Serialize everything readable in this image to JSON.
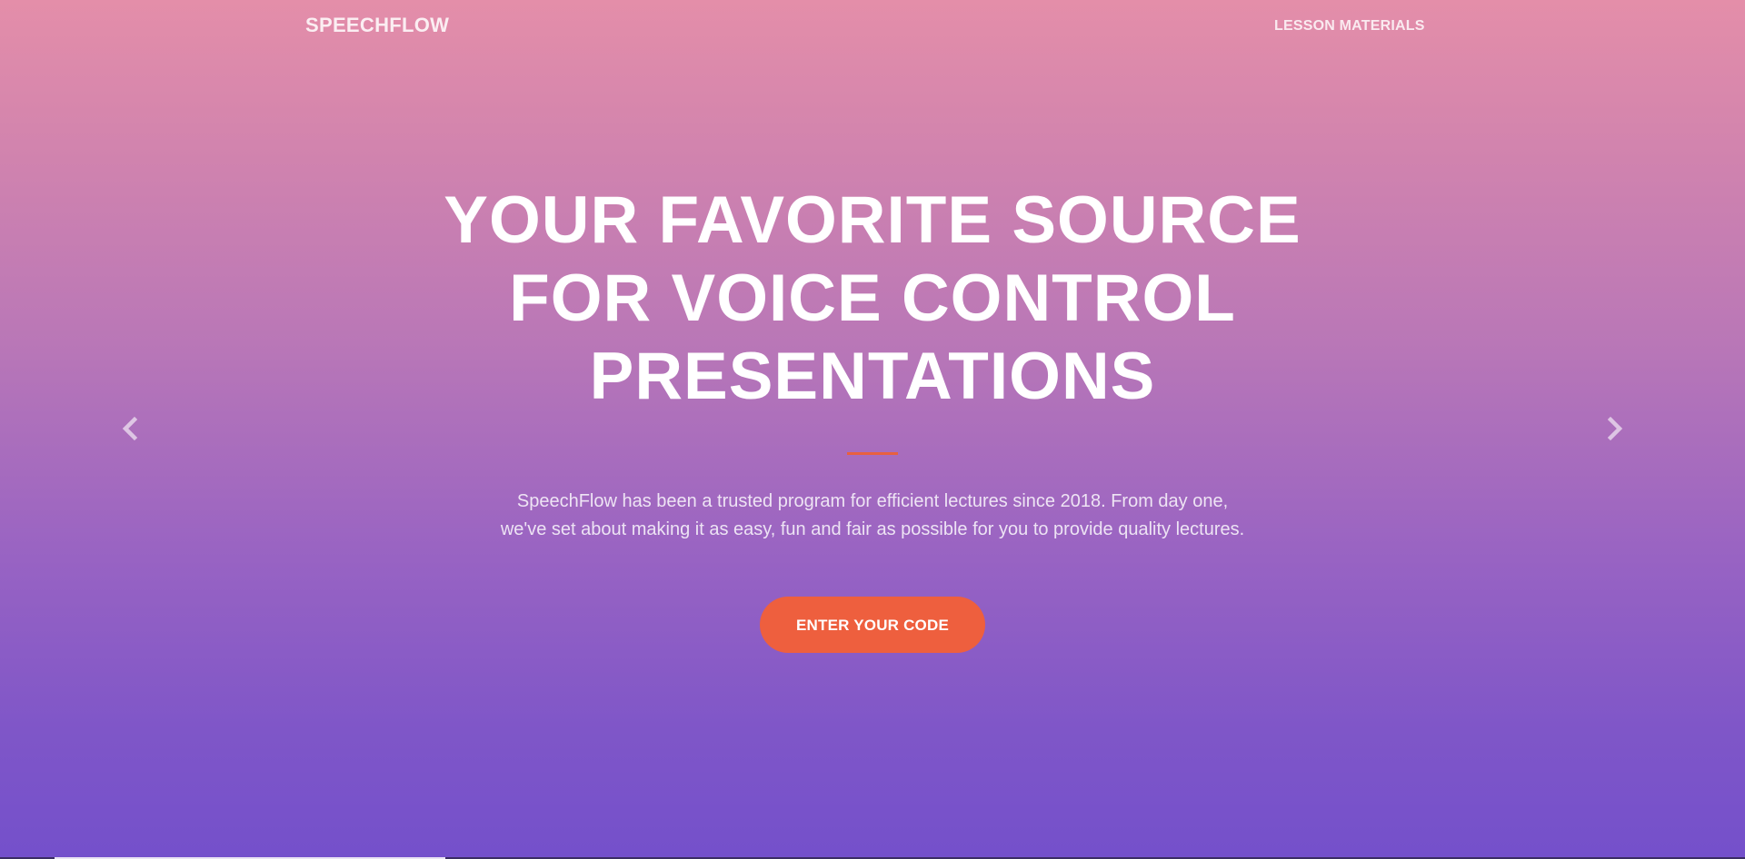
{
  "navbar": {
    "brand": "SPEECHFLOW",
    "links": [
      {
        "label": "LESSON MATERIALS"
      }
    ]
  },
  "hero": {
    "title": "YOUR FAVORITE SOURCE FOR VOICE CONTROL PRESENTATIONS",
    "description": "SpeechFlow has been a trusted program for efficient lectures since 2018. From day one, we've set about making it as easy, fun and fair as possible for you to provide quality lectures.",
    "cta_label": "ENTER YOUR CODE"
  },
  "carousel": {
    "prev_icon": "chevron-left-icon",
    "next_icon": "chevron-right-icon"
  },
  "colors": {
    "gradient_top": "#e48ea9",
    "gradient_bottom": "#7450cb",
    "accent": "#ee5f3e",
    "divider": "#e8603f"
  }
}
